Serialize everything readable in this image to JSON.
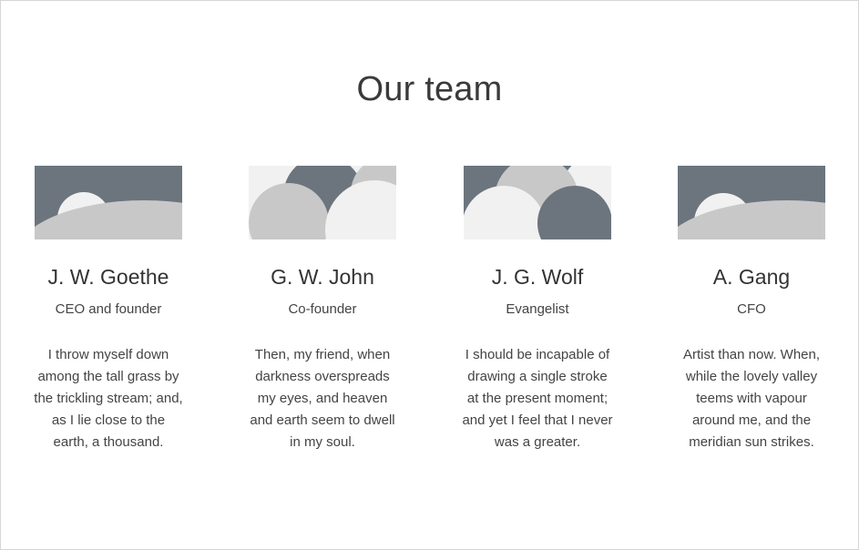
{
  "section": {
    "title": "Our team"
  },
  "colors": {
    "dark_gray": "#6c757d",
    "mid_gray": "#c8c8c8",
    "light_gray": "#f1f1f1"
  },
  "members": [
    {
      "name": "J. W. Goethe",
      "role": "CEO and founder",
      "bio": "I throw myself down among the tall grass by the trickling stream; and, as I lie close to the earth, a thousand."
    },
    {
      "name": "G. W. John",
      "role": "Co-founder",
      "bio": "Then, my friend, when darkness overspreads my eyes, and heaven and earth seem to dwell in my soul."
    },
    {
      "name": "J. G. Wolf",
      "role": "Evangelist",
      "bio": "I should be incapable of drawing a single stroke at the present moment; and yet I feel that I never was a greater."
    },
    {
      "name": "A. Gang",
      "role": "CFO",
      "bio": "Artist than now. When, while the lovely valley teems with vapour around me, and the meridian sun strikes."
    }
  ]
}
